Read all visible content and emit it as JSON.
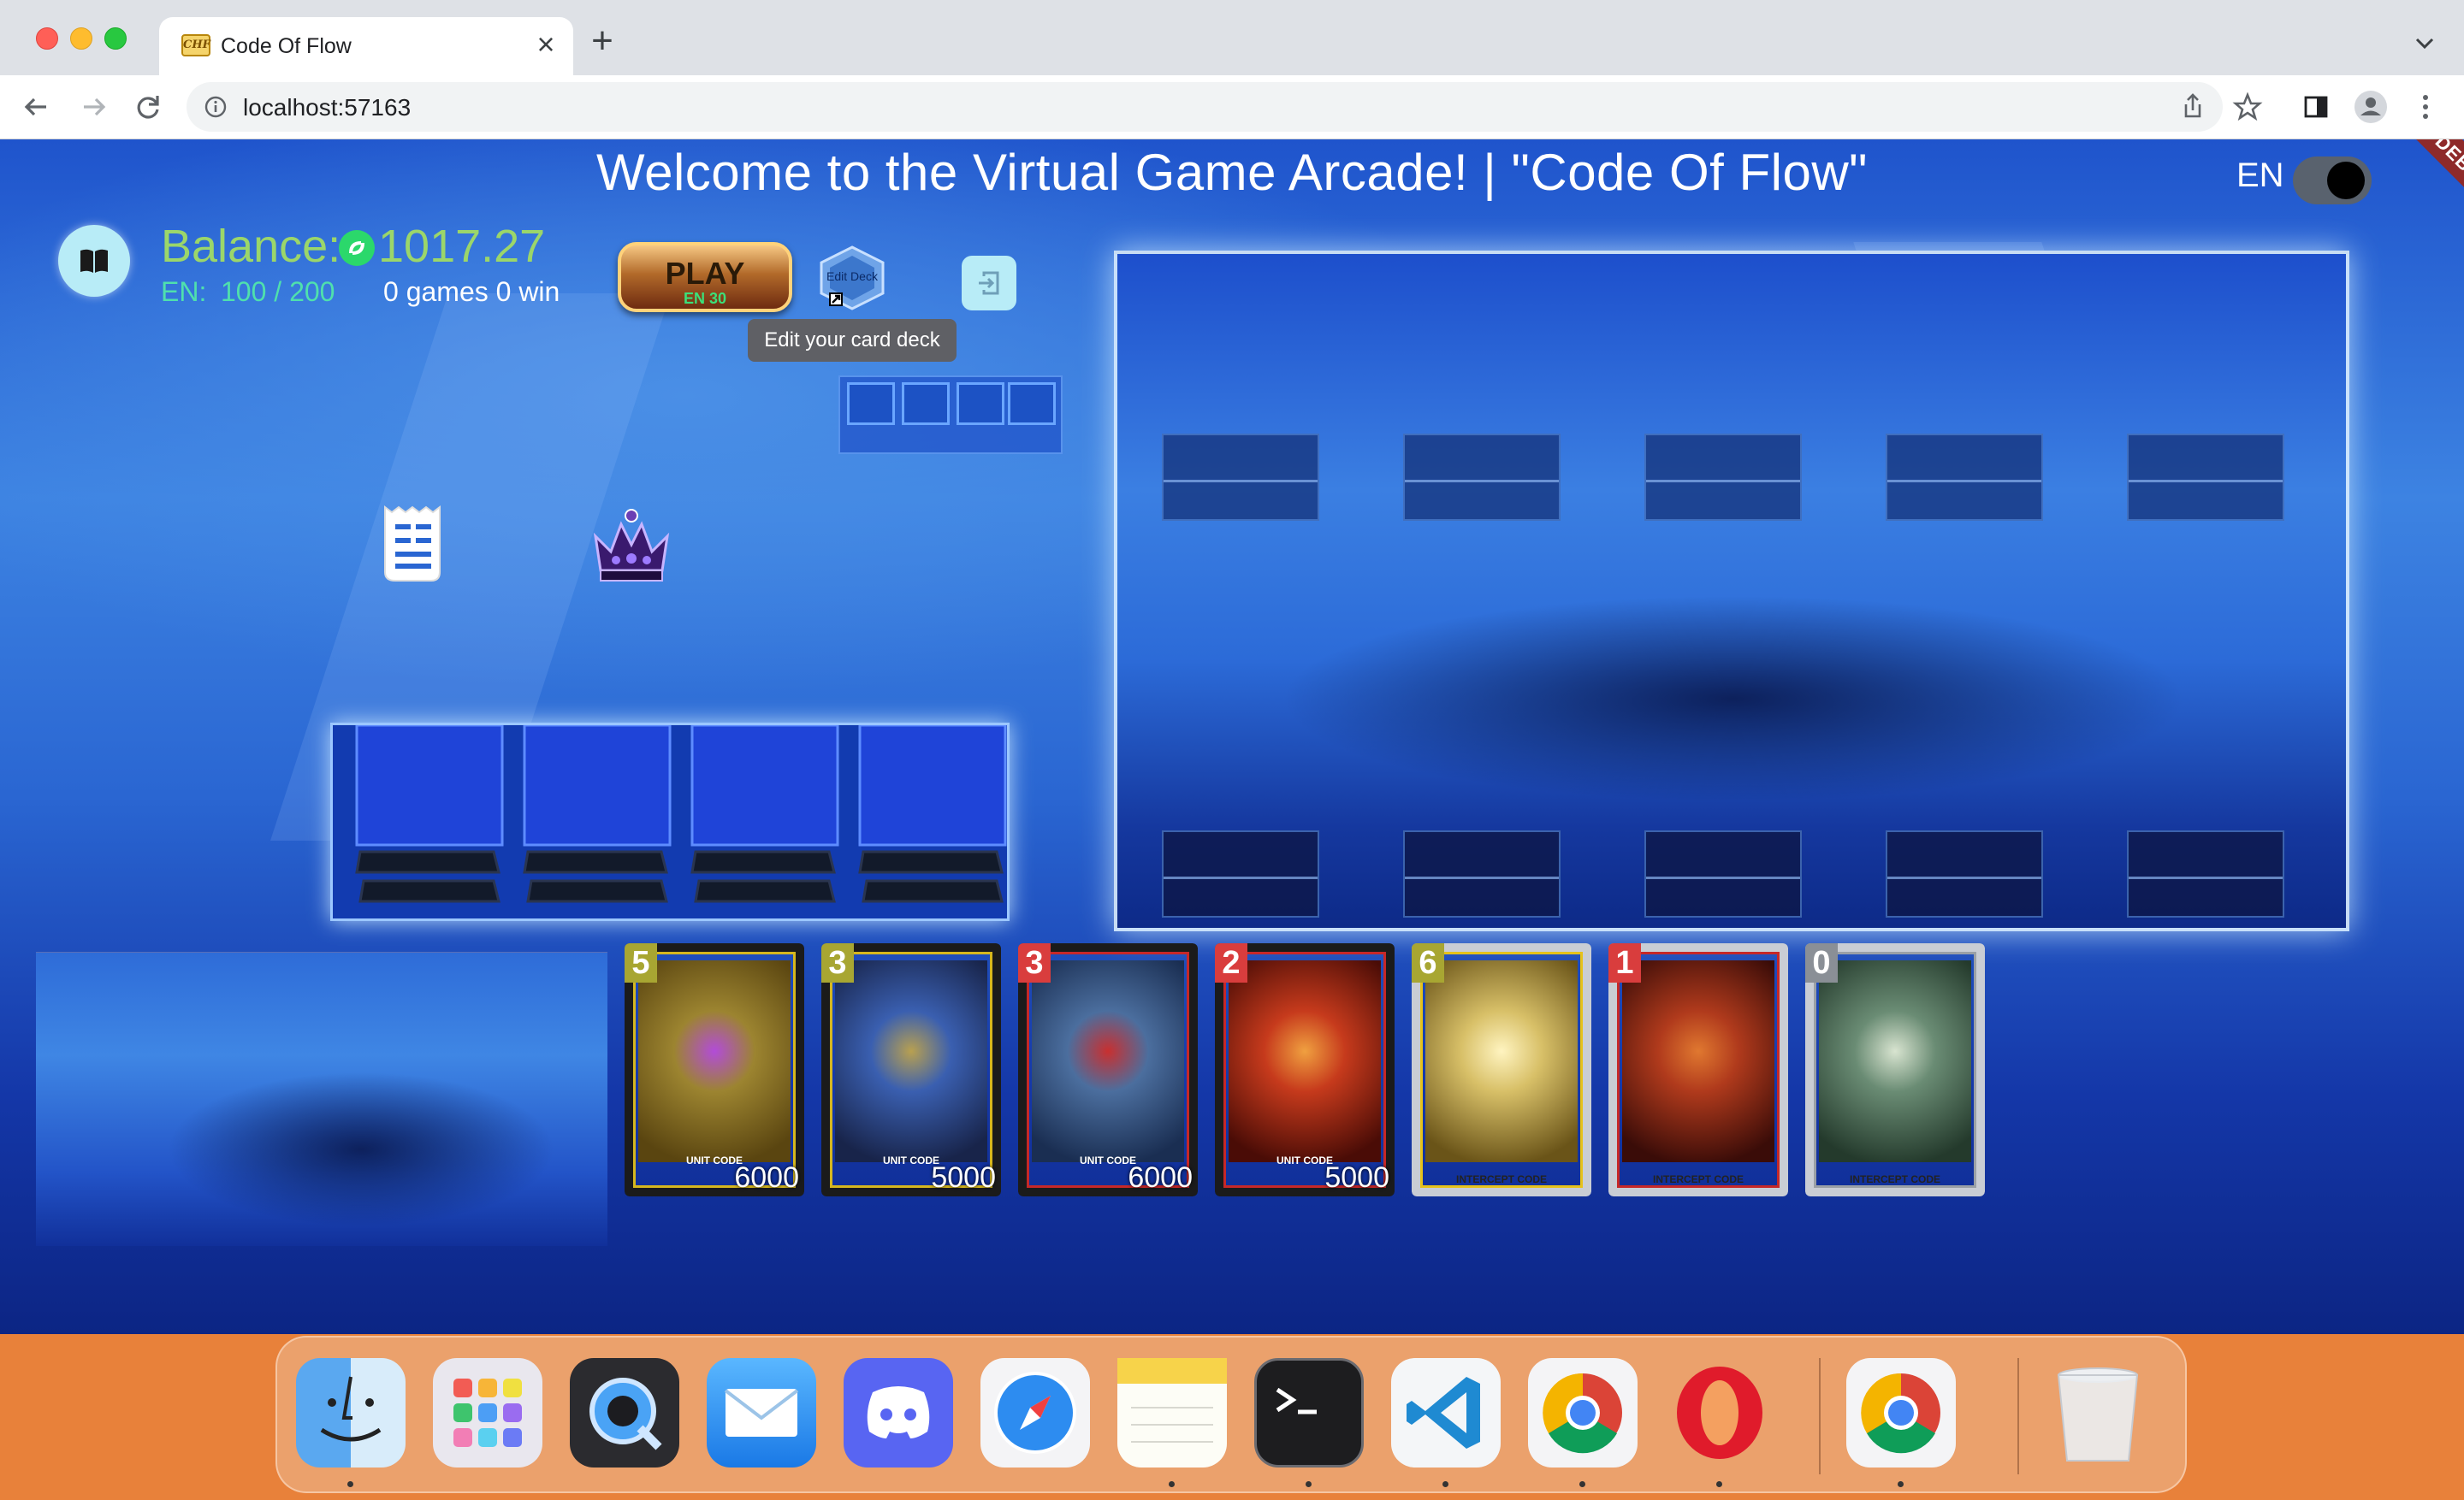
{
  "browser": {
    "tab_title": "Code Of Flow",
    "favicon_text": "CHF",
    "url": "localhost:57163"
  },
  "app": {
    "title": "Welcome to the Virtual Game Arcade! | \"Code Of Flow\"",
    "language": "EN",
    "debug_banner": "DEBUG",
    "balance_label": "Balance:",
    "balance_value": "1017.27",
    "energy_label": "EN:",
    "energy_value": "100 / 200",
    "games_summary": "0 games 0 win",
    "play_label": "PLAY",
    "play_cost": "EN 30",
    "edit_deck_label": "Edit Deck",
    "edit_deck_tooltip": "Edit your card deck"
  },
  "cards": [
    {
      "cost": "5",
      "type": "UNIT CODE",
      "power": "6000",
      "cost_color": "#a8a632",
      "frame": "#1b1b1b",
      "accent": "#d6b71e"
    },
    {
      "cost": "3",
      "type": "UNIT CODE",
      "power": "5000",
      "cost_color": "#a8a632",
      "frame": "#1b1b1b",
      "accent": "#d6b71e"
    },
    {
      "cost": "3",
      "type": "UNIT CODE",
      "power": "6000",
      "cost_color": "#d93d3d",
      "frame": "#1b1b1b",
      "accent": "#c62828"
    },
    {
      "cost": "2",
      "type": "UNIT CODE",
      "power": "5000",
      "cost_color": "#d93d3d",
      "frame": "#1b1b1b",
      "accent": "#c62828"
    },
    {
      "cost": "6",
      "type": "INTERCEPT CODE",
      "power": "",
      "cost_color": "#a8a632",
      "frame": "#c9cdd4",
      "accent": "#e6c21a"
    },
    {
      "cost": "1",
      "type": "INTERCEPT CODE",
      "power": "",
      "cost_color": "#d93d3d",
      "frame": "#c9cdd4",
      "accent": "#c62828"
    },
    {
      "cost": "0",
      "type": "INTERCEPT CODE",
      "power": "",
      "cost_color": "#8a8f96",
      "frame": "#c9cdd4",
      "accent": "#9aa0a6"
    }
  ],
  "dock": [
    "finder",
    "launchpad",
    "quicktime",
    "mail",
    "discord",
    "safari",
    "notes",
    "terminal",
    "vscode",
    "chrome",
    "opera",
    "chrome",
    "trash"
  ]
}
